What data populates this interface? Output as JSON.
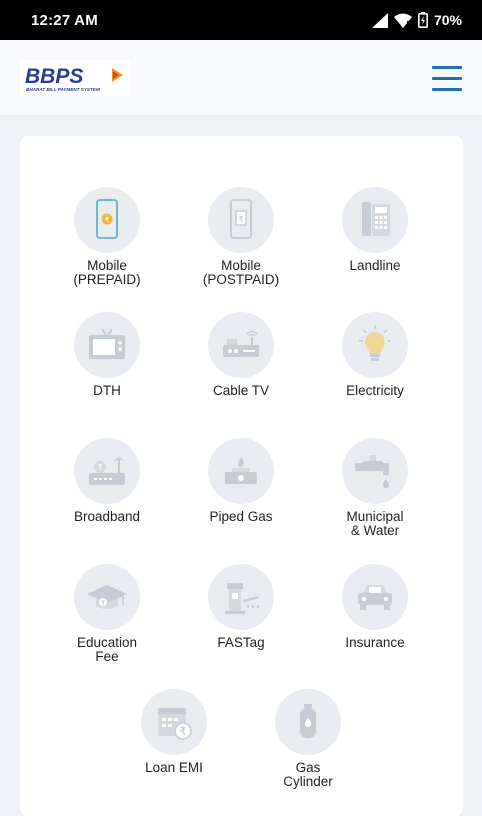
{
  "status": {
    "time": "12:27 AM",
    "battery": "70%"
  },
  "header": {
    "logo_text": "BBPS",
    "logo_subtitle": "BHARAT BILL PAYMENT SYSTEM"
  },
  "categories": [
    {
      "label": "Mobile\n(PREPAID)",
      "icon": "mobile-prepaid-icon"
    },
    {
      "label": "Mobile\n(POSTPAID)",
      "icon": "mobile-postpaid-icon"
    },
    {
      "label": "Landline",
      "icon": "landline-phone-icon"
    },
    {
      "label": "DTH",
      "icon": "tv-icon"
    },
    {
      "label": "Cable TV",
      "icon": "cable-box-icon"
    },
    {
      "label": "Electricity",
      "icon": "light-bulb-icon"
    },
    {
      "label": "Broadband",
      "icon": "router-icon"
    },
    {
      "label": "Piped Gas",
      "icon": "gas-stove-icon"
    },
    {
      "label": "Municipal\n& Water",
      "icon": "water-tap-icon"
    },
    {
      "label": "Education\nFee",
      "icon": "graduation-cap-icon"
    },
    {
      "label": "FASTag",
      "icon": "toll-booth-icon"
    },
    {
      "label": "Insurance",
      "icon": "car-icon"
    },
    {
      "label": "Loan EMI",
      "icon": "calendar-rupee-icon"
    },
    {
      "label": "Gas\nCylinder",
      "icon": "gas-cylinder-icon"
    }
  ],
  "colors": {
    "accent": "#1f6fb8",
    "icon_tint": "#c5ccd6",
    "circle_bg": "#e8ecf1"
  }
}
